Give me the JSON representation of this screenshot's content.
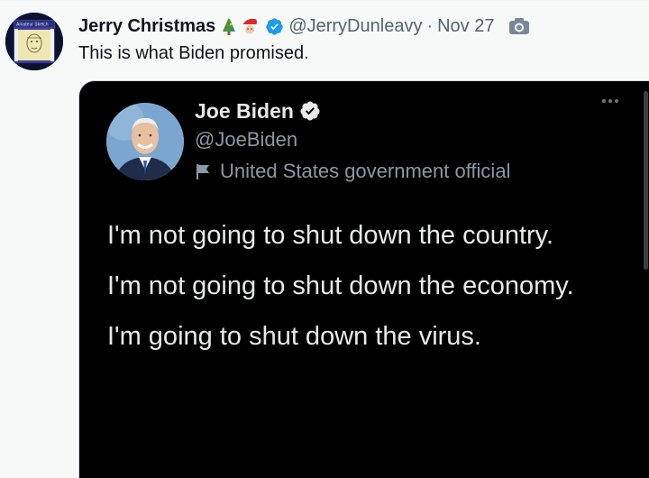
{
  "tweet": {
    "display_name": "Jerry Christmas",
    "emoji": [
      "christmas-tree",
      "santa"
    ],
    "handle": "@JerryDunleavy",
    "separator": "·",
    "date": "Nov 27",
    "text": "This is what Biden promised.",
    "avatar_text": "Amateur Sketch"
  },
  "quoted": {
    "name": "Joe Biden",
    "handle": "@JoeBiden",
    "label": "United States government official",
    "lines": [
      "I'm not going to shut down the country.",
      "I'm not going to shut down the economy.",
      "I'm going to shut down the virus."
    ]
  },
  "colors": {
    "verified_blue": "#1d9bf0",
    "media_background": "#000000",
    "page_background": "#f7f9f9"
  }
}
